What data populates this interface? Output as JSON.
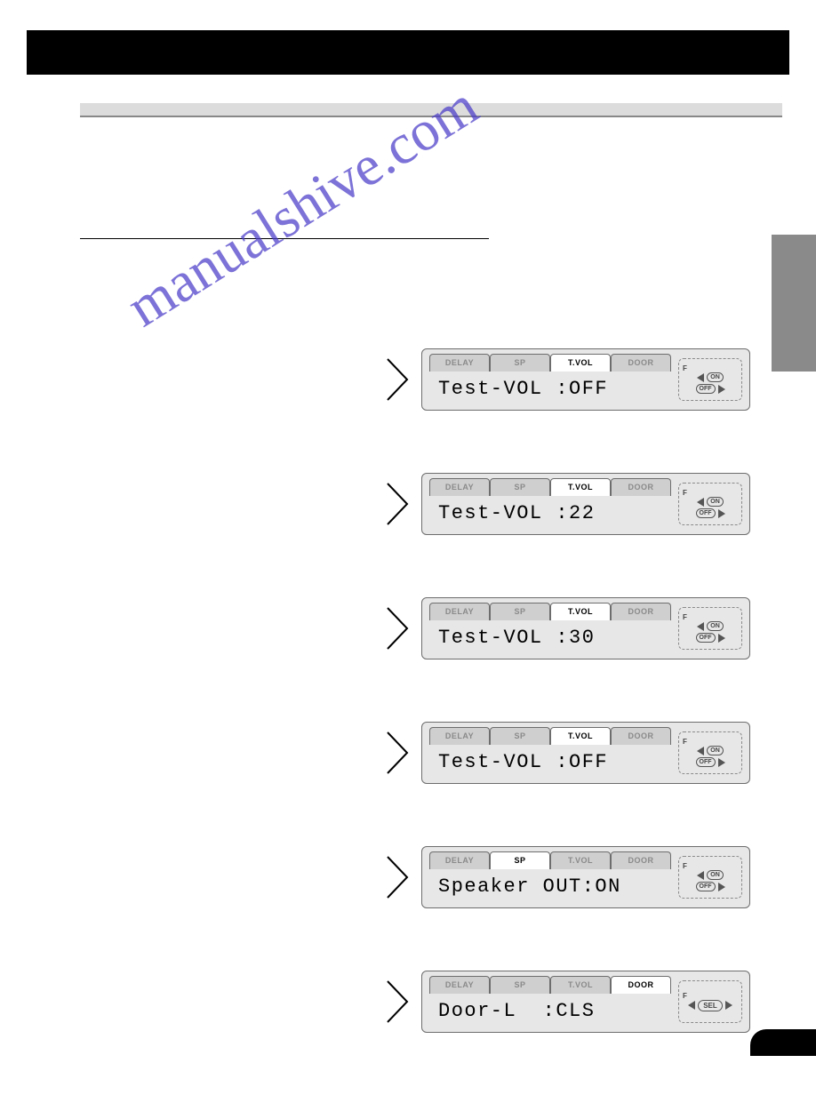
{
  "tabs": {
    "t1": "DELAY",
    "t2": "SP",
    "t3": "T.VOL",
    "t4": "DOOR"
  },
  "side_labels": {
    "f": "F",
    "on": "ON",
    "off": "OFF",
    "sel": "SEL"
  },
  "watermark": "manualshive.com",
  "screens": [
    {
      "active": "t3",
      "text": "Test-VOL :OFF",
      "side": "onoff"
    },
    {
      "active": "t3",
      "text": "Test-VOL :22",
      "side": "onoff"
    },
    {
      "active": "t3",
      "text": "Test-VOL :30",
      "side": "onoff"
    },
    {
      "active": "t3",
      "text": "Test-VOL :OFF",
      "side": "onoff"
    },
    {
      "active": "t2",
      "text": "Speaker OUT:ON",
      "side": "onoff"
    },
    {
      "active": "t4",
      "text": "Door-L  :CLS",
      "side": "sel"
    }
  ]
}
